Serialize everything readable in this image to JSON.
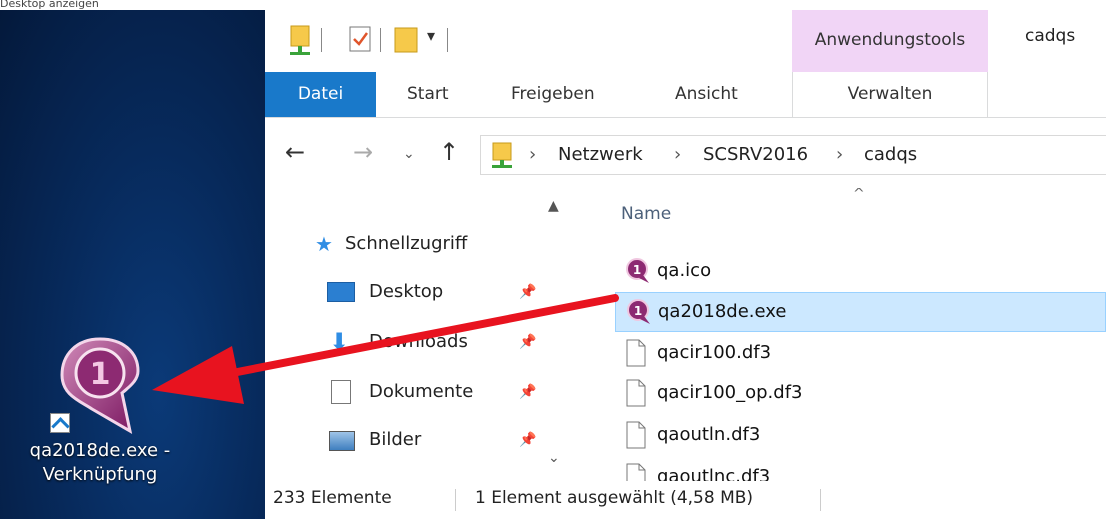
{
  "top_strip_text": "Desktop anzeigen",
  "desktop": {
    "shortcut_label_line1": "qa2018de.exe -",
    "shortcut_label_line2": "Verknüpfung",
    "shortcut_badge": "1",
    "background_color": "#072a5c"
  },
  "window": {
    "title": "cadqs",
    "context_tab_group": "Anwendungstools",
    "context_color": "#f1d5f6"
  },
  "ribbon": {
    "tabs": [
      "Datei",
      "Start",
      "Freigeben",
      "Ansicht"
    ],
    "context_tab": "Verwalten",
    "accent": "#1979ca"
  },
  "address": {
    "crumbs": [
      "Netzwerk",
      "SCSRV2016",
      "cadqs"
    ]
  },
  "nav_pane": {
    "items": [
      {
        "label": "Schnellzugriff",
        "icon": "star-icon"
      },
      {
        "label": "Desktop",
        "icon": "desktop-folder-icon"
      },
      {
        "label": "Downloads",
        "icon": "download-arrow-icon"
      },
      {
        "label": "Dokumente",
        "icon": "documents-icon"
      },
      {
        "label": "Bilder",
        "icon": "pictures-icon"
      }
    ]
  },
  "file_list": {
    "column_name": "Name",
    "files": [
      {
        "name": "qa.ico",
        "icon": "qa-app-icon",
        "selected": false
      },
      {
        "name": "qa2018de.exe",
        "icon": "qa-app-icon",
        "selected": true
      },
      {
        "name": "qacir100.df3",
        "icon": "file-icon",
        "selected": false
      },
      {
        "name": "qacir100_op.df3",
        "icon": "file-icon",
        "selected": false
      },
      {
        "name": "qaoutln.df3",
        "icon": "file-icon",
        "selected": false
      },
      {
        "name": "qaoutlnc.df3",
        "icon": "file-icon",
        "selected": false
      }
    ]
  },
  "status": {
    "count": "233 Elemente",
    "selection": "1 Element ausgewählt (4,58 MB)"
  },
  "annotation_color": "#e8131f"
}
